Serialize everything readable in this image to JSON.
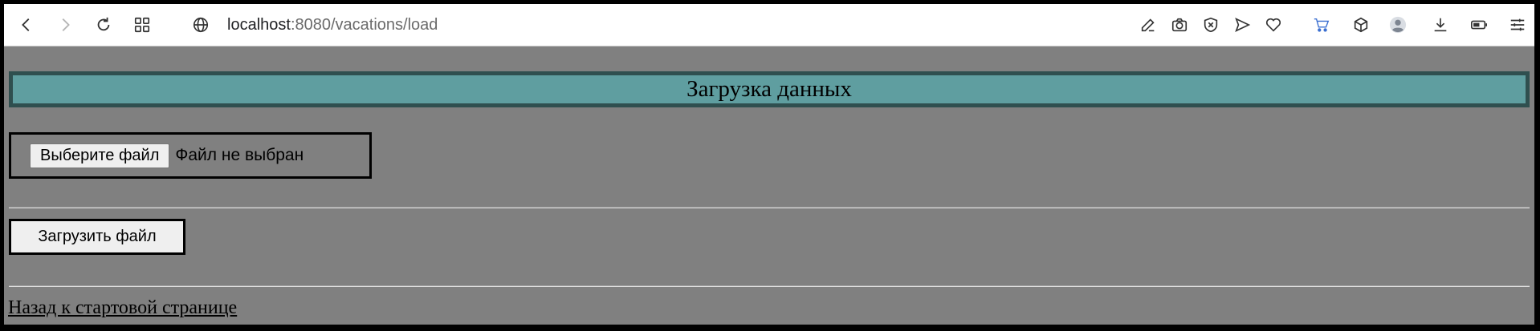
{
  "browser": {
    "url_host": "localhost",
    "url_rest": ":8080/vacations/load",
    "icons": [
      "back-icon",
      "forward-icon",
      "reload-icon",
      "apps-grid-icon",
      "globe-icon",
      "edit-icon",
      "camera-icon",
      "shield-x-icon",
      "send-icon",
      "heart-icon",
      "cart-icon",
      "cube-icon",
      "profile-avatar",
      "download-icon",
      "battery-icon",
      "menu-icon"
    ]
  },
  "page": {
    "heading": "Загрузка данных",
    "choose_file_label": "Выберите файл",
    "file_status": "Файл не выбран",
    "upload_button_label": "Загрузить файл",
    "back_link_label": "Назад к стартовой странице"
  },
  "colors": {
    "page_background": "#808080",
    "heading_background": "#5f9ea0",
    "heading_border": "#2f4f4f",
    "cart_accent": "#3b6fd1"
  }
}
